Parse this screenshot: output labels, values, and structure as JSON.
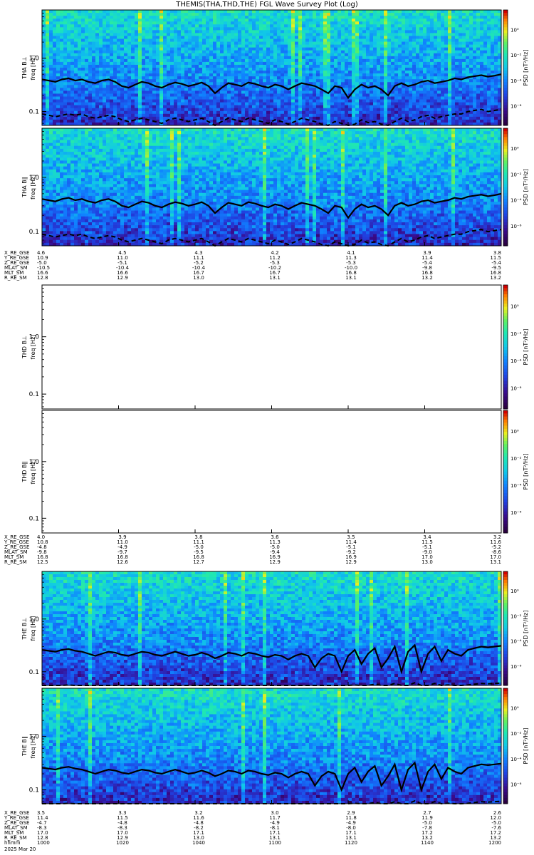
{
  "title": "THEMIS(THA,THD,THE) FGL Wave Survey Plot (Log)",
  "date": "2025 Mar 20",
  "colorbar": {
    "label": "PSD [nT²/Hz]",
    "tick_labels": [
      "10⁰",
      "10⁻²",
      "10⁻⁴",
      "10⁻⁶"
    ]
  },
  "chart_data": [
    {
      "type": "heatmap",
      "probe_label": "THA B⊥",
      "ylabel": "freq [Hz]",
      "yscale": "log",
      "ylim": [
        0.055,
        8.0
      ],
      "yticks": [
        "1.0",
        "0.1"
      ],
      "has_data": true,
      "seed": 11,
      "curve_solid": [
        0.4,
        0.38,
        0.36,
        0.4,
        0.42,
        0.38,
        0.4,
        0.36,
        0.34,
        0.38,
        0.4,
        0.36,
        0.3,
        0.28,
        0.32,
        0.36,
        0.34,
        0.3,
        0.28,
        0.32,
        0.35,
        0.33,
        0.3,
        0.32,
        0.35,
        0.3,
        0.22,
        0.28,
        0.34,
        0.32,
        0.3,
        0.35,
        0.33,
        0.3,
        0.28,
        0.32,
        0.3,
        0.26,
        0.3,
        0.34,
        0.32,
        0.3,
        0.26,
        0.22,
        0.3,
        0.28,
        0.18,
        0.26,
        0.32,
        0.28,
        0.3,
        0.26,
        0.2,
        0.3,
        0.34,
        0.3,
        0.32,
        0.36,
        0.38,
        0.34,
        0.36,
        0.38,
        0.42,
        0.4,
        0.44,
        0.46,
        0.48,
        0.45,
        0.47,
        0.5
      ],
      "curve_dashed": [
        0.09,
        0.085,
        0.08,
        0.085,
        0.09,
        0.085,
        0.09,
        0.08,
        0.075,
        0.08,
        0.085,
        0.08,
        0.07,
        0.065,
        0.07,
        0.075,
        0.07,
        0.065,
        0.06,
        0.07,
        0.075,
        0.07,
        0.065,
        0.07,
        0.075,
        0.065,
        0.055,
        0.065,
        0.075,
        0.07,
        0.065,
        0.075,
        0.07,
        0.065,
        0.06,
        0.07,
        0.065,
        0.058,
        0.065,
        0.075,
        0.07,
        0.065,
        0.058,
        0.052,
        0.065,
        0.06,
        0.05,
        0.058,
        0.07,
        0.062,
        0.065,
        0.058,
        0.05,
        0.065,
        0.075,
        0.065,
        0.07,
        0.08,
        0.085,
        0.075,
        0.08,
        0.085,
        0.09,
        0.09,
        0.1,
        0.105,
        0.11,
        0.1,
        0.105,
        0.11
      ]
    },
    {
      "type": "heatmap",
      "probe_label": "THA B∥",
      "ylabel": "freq [Hz]",
      "yscale": "log",
      "ylim": [
        0.055,
        8.0
      ],
      "yticks": [
        "1.0",
        "0.1"
      ],
      "has_data": true,
      "seed": 23,
      "curve_solid": [
        0.4,
        0.38,
        0.36,
        0.4,
        0.42,
        0.38,
        0.4,
        0.36,
        0.34,
        0.38,
        0.4,
        0.36,
        0.3,
        0.28,
        0.32,
        0.36,
        0.34,
        0.3,
        0.28,
        0.32,
        0.35,
        0.33,
        0.3,
        0.32,
        0.35,
        0.3,
        0.22,
        0.28,
        0.34,
        0.32,
        0.3,
        0.35,
        0.33,
        0.3,
        0.28,
        0.32,
        0.3,
        0.26,
        0.3,
        0.34,
        0.32,
        0.3,
        0.26,
        0.22,
        0.3,
        0.28,
        0.18,
        0.26,
        0.32,
        0.28,
        0.3,
        0.26,
        0.2,
        0.3,
        0.34,
        0.3,
        0.32,
        0.36,
        0.38,
        0.34,
        0.36,
        0.38,
        0.42,
        0.4,
        0.44,
        0.46,
        0.48,
        0.45,
        0.47,
        0.5
      ],
      "curve_dashed": [
        0.09,
        0.085,
        0.08,
        0.085,
        0.09,
        0.085,
        0.09,
        0.08,
        0.075,
        0.08,
        0.085,
        0.08,
        0.07,
        0.065,
        0.07,
        0.075,
        0.07,
        0.065,
        0.06,
        0.07,
        0.075,
        0.07,
        0.065,
        0.07,
        0.075,
        0.065,
        0.055,
        0.065,
        0.075,
        0.07,
        0.065,
        0.075,
        0.07,
        0.065,
        0.06,
        0.07,
        0.065,
        0.058,
        0.065,
        0.075,
        0.07,
        0.065,
        0.058,
        0.052,
        0.065,
        0.06,
        0.05,
        0.058,
        0.07,
        0.062,
        0.065,
        0.058,
        0.05,
        0.065,
        0.075,
        0.065,
        0.07,
        0.08,
        0.085,
        0.075,
        0.08,
        0.085,
        0.09,
        0.09,
        0.1,
        0.105,
        0.11,
        0.1,
        0.105,
        0.11
      ]
    },
    {
      "type": "heatmap",
      "probe_label": "THD B⊥",
      "ylabel": "freq [Hz]",
      "yscale": "log",
      "ylim": [
        0.055,
        8.0
      ],
      "yticks": [
        "1.0",
        "0.1"
      ],
      "has_data": false
    },
    {
      "type": "heatmap",
      "probe_label": "THD B∥",
      "ylabel": "freq [Hz]",
      "yscale": "log",
      "ylim": [
        0.055,
        8.0
      ],
      "yticks": [
        "1.0",
        "0.1"
      ],
      "has_data": false
    },
    {
      "type": "heatmap",
      "probe_label": "THE B⊥",
      "ylabel": "freq [Hz]",
      "yscale": "log",
      "ylim": [
        0.055,
        8.0
      ],
      "yticks": [
        "1.0",
        "0.1"
      ],
      "has_data": true,
      "seed": 37,
      "curve_solid": [
        0.26,
        0.25,
        0.24,
        0.26,
        0.27,
        0.25,
        0.24,
        0.22,
        0.2,
        0.22,
        0.24,
        0.23,
        0.21,
        0.2,
        0.22,
        0.24,
        0.23,
        0.21,
        0.2,
        0.22,
        0.24,
        0.22,
        0.2,
        0.21,
        0.23,
        0.21,
        0.18,
        0.2,
        0.23,
        0.22,
        0.2,
        0.23,
        0.22,
        0.2,
        0.19,
        0.21,
        0.2,
        0.17,
        0.2,
        0.22,
        0.2,
        0.12,
        0.18,
        0.22,
        0.2,
        0.1,
        0.2,
        0.26,
        0.14,
        0.22,
        0.28,
        0.12,
        0.18,
        0.3,
        0.1,
        0.24,
        0.32,
        0.1,
        0.22,
        0.3,
        0.16,
        0.26,
        0.22,
        0.2,
        0.26,
        0.28,
        0.3,
        0.29,
        0.3,
        0.31
      ],
      "curve_dashed": [
        0.055,
        0.054,
        0.053,
        0.055,
        0.056,
        0.054,
        0.053,
        0.052,
        0.05,
        0.052,
        0.054,
        0.053,
        0.051,
        0.05,
        0.052,
        0.054,
        0.053,
        0.051,
        0.05,
        0.052,
        0.054,
        0.052,
        0.05,
        0.051,
        0.053,
        0.051,
        0.048,
        0.05,
        0.053,
        0.052,
        0.05,
        0.053,
        0.052,
        0.05,
        0.049,
        0.051,
        0.05,
        0.047,
        0.05,
        0.052,
        0.05,
        0.045,
        0.048,
        0.052,
        0.05,
        0.045,
        0.05,
        0.056,
        0.046,
        0.052,
        0.058,
        0.045,
        0.048,
        0.06,
        0.045,
        0.054,
        0.062,
        0.045,
        0.052,
        0.06,
        0.048,
        0.056,
        0.052,
        0.05,
        0.056,
        0.058,
        0.06,
        0.059,
        0.06,
        0.061
      ]
    },
    {
      "type": "heatmap",
      "probe_label": "THE B∥",
      "ylabel": "freq [Hz]",
      "yscale": "log",
      "ylim": [
        0.055,
        8.0
      ],
      "yticks": [
        "1.0",
        "0.1"
      ],
      "has_data": true,
      "seed": 51,
      "curve_solid": [
        0.26,
        0.25,
        0.24,
        0.26,
        0.27,
        0.25,
        0.24,
        0.22,
        0.2,
        0.22,
        0.24,
        0.23,
        0.21,
        0.2,
        0.22,
        0.24,
        0.23,
        0.21,
        0.2,
        0.22,
        0.24,
        0.22,
        0.2,
        0.21,
        0.23,
        0.21,
        0.18,
        0.2,
        0.23,
        0.22,
        0.2,
        0.23,
        0.22,
        0.2,
        0.19,
        0.21,
        0.2,
        0.17,
        0.2,
        0.22,
        0.2,
        0.12,
        0.18,
        0.22,
        0.2,
        0.1,
        0.2,
        0.26,
        0.14,
        0.22,
        0.28,
        0.12,
        0.18,
        0.3,
        0.1,
        0.24,
        0.32,
        0.1,
        0.22,
        0.3,
        0.16,
        0.26,
        0.22,
        0.2,
        0.26,
        0.28,
        0.3,
        0.29,
        0.3,
        0.31
      ],
      "curve_dashed": [
        0.055,
        0.054,
        0.053,
        0.055,
        0.056,
        0.054,
        0.053,
        0.052,
        0.05,
        0.052,
        0.054,
        0.053,
        0.051,
        0.05,
        0.052,
        0.054,
        0.053,
        0.051,
        0.05,
        0.052,
        0.054,
        0.052,
        0.05,
        0.051,
        0.053,
        0.051,
        0.048,
        0.05,
        0.053,
        0.052,
        0.05,
        0.053,
        0.052,
        0.05,
        0.049,
        0.051,
        0.05,
        0.047,
        0.05,
        0.052,
        0.05,
        0.045,
        0.048,
        0.052,
        0.05,
        0.045,
        0.05,
        0.056,
        0.046,
        0.052,
        0.058,
        0.045,
        0.048,
        0.06,
        0.045,
        0.054,
        0.062,
        0.045,
        0.052,
        0.06,
        0.048,
        0.056,
        0.052,
        0.05,
        0.056,
        0.058,
        0.06,
        0.059,
        0.06,
        0.061
      ]
    }
  ],
  "ephemeris": [
    {
      "labels": [
        "X_RE_GSE",
        "Y_RE_GSE",
        "Z_RE_GSE",
        "MLAT_SM",
        "MLT_SM",
        "R_RE_SM"
      ],
      "rows": [
        [
          "4.6",
          "4.5",
          "4.3",
          "4.2",
          "4.1",
          "3.9",
          "3.8"
        ],
        [
          "10.9",
          "11.0",
          "11.1",
          "11.2",
          "11.3",
          "11.4",
          "11.5"
        ],
        [
          "-5.0",
          "-5.1",
          "-5.2",
          "-5.3",
          "-5.3",
          "-5.4",
          "-5.4"
        ],
        [
          "-10.5",
          "-10.4",
          "-10.4",
          "-10.2",
          "-10.0",
          "-9.8",
          "-9.5"
        ],
        [
          "16.6",
          "16.6",
          "16.7",
          "16.7",
          "16.8",
          "16.8",
          "16.8"
        ],
        [
          "12.8",
          "12.9",
          "13.0",
          "13.1",
          "13.1",
          "13.2",
          "13.2"
        ]
      ]
    },
    {
      "labels": [
        "X_RE_GSE",
        "Y_RE_GSE",
        "Z_RE_GSE",
        "MLAT_SM",
        "MLT_SM",
        "R_RE_SM"
      ],
      "rows": [
        [
          "4.0",
          "3.9",
          "3.8",
          "3.6",
          "3.5",
          "3.4",
          "3.2"
        ],
        [
          "10.8",
          "11.0",
          "11.1",
          "11.3",
          "11.4",
          "11.5",
          "11.6"
        ],
        [
          "-4.8",
          "-4.9",
          "-5.0",
          "-5.0",
          "-5.1",
          "-5.1",
          "-5.2"
        ],
        [
          "-9.8",
          "-9.7",
          "-9.5",
          "-9.4",
          "-9.2",
          "-9.0",
          "-8.6"
        ],
        [
          "16.8",
          "16.8",
          "16.8",
          "16.9",
          "16.9",
          "17.0",
          "17.0"
        ],
        [
          "12.5",
          "12.6",
          "12.7",
          "12.9",
          "12.9",
          "13.0",
          "13.1"
        ]
      ]
    },
    {
      "labels": [
        "X_RE_GSE",
        "Y_RE_GSE",
        "Z_RE_GSE",
        "MLAT_SM",
        "MLT_SM",
        "R_RE_SM",
        "hhmm"
      ],
      "rows": [
        [
          "3.5",
          "3.3",
          "3.2",
          "3.0",
          "2.9",
          "2.7",
          "2.6"
        ],
        [
          "11.4",
          "11.5",
          "11.6",
          "11.7",
          "11.8",
          "11.9",
          "12.0"
        ],
        [
          "-4.7",
          "-4.8",
          "-4.8",
          "-4.9",
          "-4.9",
          "-5.0",
          "-5.0"
        ],
        [
          "-8.3",
          "-8.3",
          "-8.2",
          "-8.1",
          "-8.0",
          "-7.8",
          "-7.6"
        ],
        [
          "17.0",
          "17.0",
          "17.1",
          "17.1",
          "17.1",
          "17.2",
          "17.2"
        ],
        [
          "12.8",
          "12.9",
          "13.0",
          "13.1",
          "13.1",
          "13.2",
          "13.2"
        ],
        [
          "1000",
          "1020",
          "1040",
          "1100",
          "1120",
          "1140",
          "1200"
        ]
      ]
    }
  ]
}
